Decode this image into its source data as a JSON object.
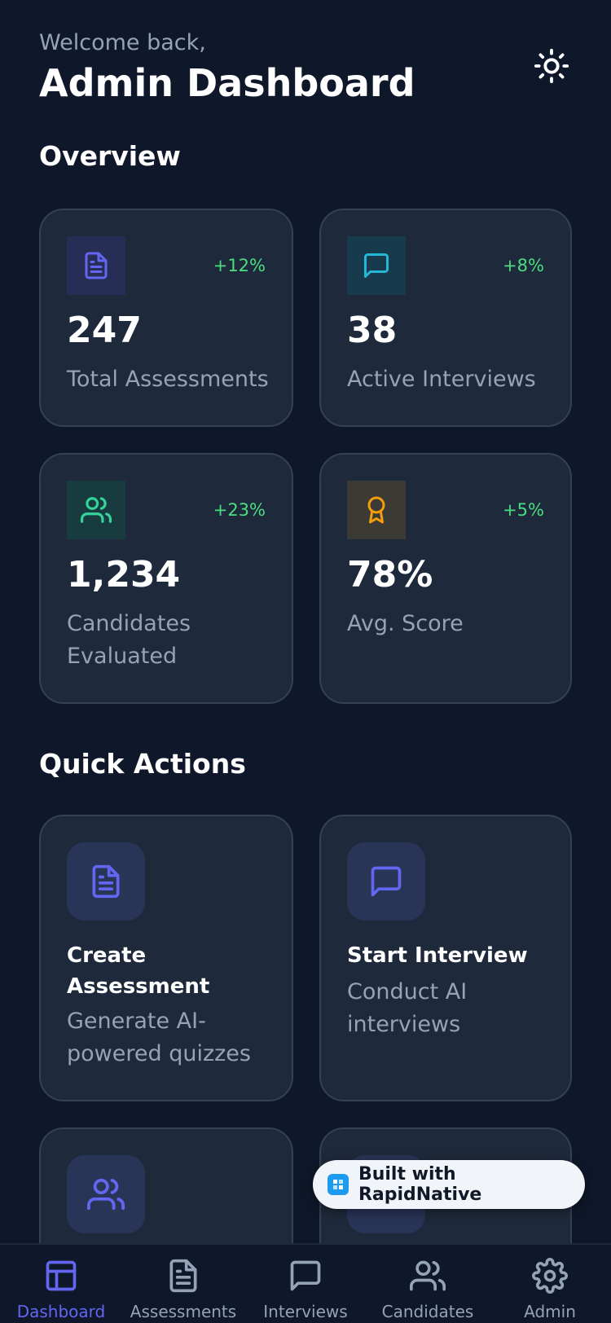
{
  "header": {
    "welcome": "Welcome back,",
    "title": "Admin Dashboard",
    "theme_icon": "sun-icon"
  },
  "overview": {
    "title": "Overview",
    "stats": [
      {
        "value": "247",
        "label": "Total Assessments",
        "change": "+12%",
        "icon": "document-icon",
        "color": "#6366f1",
        "bg": "#272e55"
      },
      {
        "value": "38",
        "label": "Active Interviews",
        "change": "+8%",
        "icon": "chat-icon",
        "color": "#22b8d6",
        "bg": "#173a4c"
      },
      {
        "value": "1,234",
        "label": "Candidates Evaluated",
        "change": "+23%",
        "icon": "users-icon",
        "color": "#34d399",
        "bg": "#183b3f"
      },
      {
        "value": "78%",
        "label": "Avg. Score",
        "change": "+5%",
        "icon": "award-icon",
        "color": "#f59e0b",
        "bg": "#3b3a34"
      }
    ]
  },
  "quick_actions": {
    "title": "Quick Actions",
    "items": [
      {
        "title": "Create Assessment",
        "desc": "Generate AI-powered quizzes",
        "icon": "document-icon"
      },
      {
        "title": "Start Interview",
        "desc": "Conduct AI interviews",
        "icon": "chat-icon"
      },
      {
        "title": "",
        "desc": "",
        "icon": "users-icon"
      },
      {
        "title": "",
        "desc": "",
        "icon": "chat-icon"
      }
    ]
  },
  "badge": {
    "text": "Built with RapidNative"
  },
  "tabs": [
    {
      "label": "Dashboard",
      "icon": "dashboard-icon",
      "active": true
    },
    {
      "label": "Assessments",
      "icon": "document-icon",
      "active": false
    },
    {
      "label": "Interviews",
      "icon": "chat-icon",
      "active": false
    },
    {
      "label": "Candidates",
      "icon": "users-icon",
      "active": false
    },
    {
      "label": "Admin",
      "icon": "gear-icon",
      "active": false
    }
  ],
  "colors": {
    "accent": "#6366f1",
    "positive": "#4ade80",
    "muted": "#94a3b8",
    "card": "#1e293b",
    "background": "#0f172a"
  }
}
